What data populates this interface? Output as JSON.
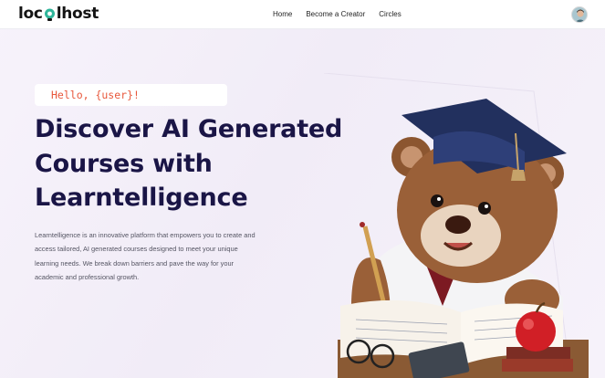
{
  "header": {
    "logo_prefix": "loc",
    "logo_suffix": "lhost",
    "nav": [
      "Home",
      "Become a Creator",
      "Circles"
    ]
  },
  "hero": {
    "greeting": "Hello, {user}!",
    "title_lines": [
      "Discover AI Generated",
      "Courses with",
      "Learntelligence"
    ],
    "description_lines": [
      "Learntelligence is an innovative platform that empowers you to create and",
      "access tailored, AI generated courses designed to meet your unique",
      "learning needs. We break down barriers and pave the way for your",
      "academic and professional growth."
    ]
  },
  "colors": {
    "accent": "#e8573b",
    "title": "#1a1546",
    "background": "#f3eef8"
  }
}
